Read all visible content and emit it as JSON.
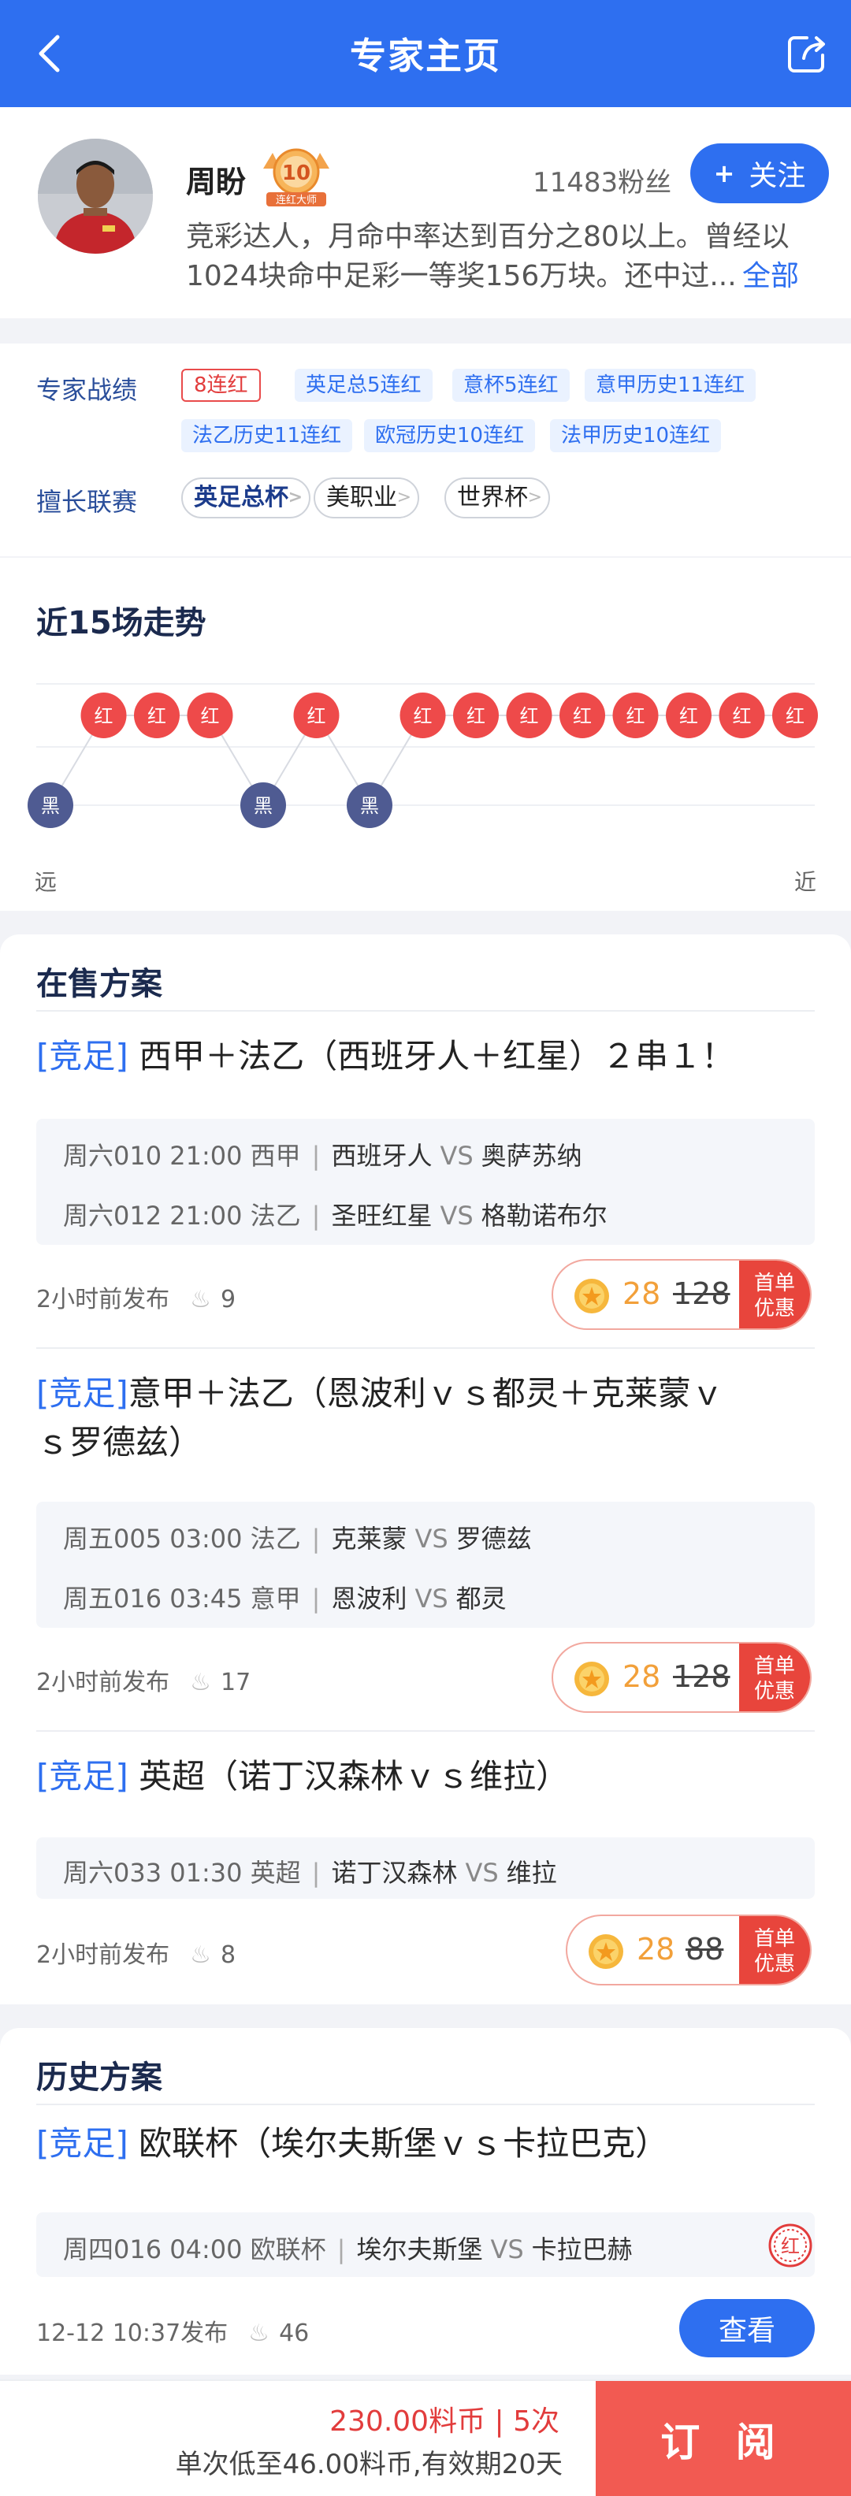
{
  "header": {
    "title": "专家主页",
    "accent": "#2e6ff0"
  },
  "profile": {
    "name": "周盼",
    "medal_number": "10",
    "medal_label": "连红大师",
    "fans": "11483粉丝",
    "follow_label": "关注",
    "bio_line1": "竞彩达人，月命中率达到百分之80以上。曾经以",
    "bio_line2": "1024块命中足彩一等奖156万块。还中过...",
    "bio_more": "全部"
  },
  "records": {
    "label": "专家战绩",
    "tags": [
      "8连红",
      "英足总5连红",
      "意杯5连红",
      "意甲历史11连红",
      "法乙历史11连红",
      "欧冠历史10连红",
      "法甲历史10连红"
    ],
    "league_label": "擅长联赛",
    "leagues": [
      "英足总杯",
      "美职业",
      "世界杯"
    ]
  },
  "trend": {
    "title": "近15场走势",
    "results": [
      "黑",
      "红",
      "红",
      "红",
      "黑",
      "红",
      "黑",
      "红",
      "红",
      "红",
      "红",
      "红",
      "红",
      "红",
      "红"
    ],
    "far_label": "远",
    "near_label": "近",
    "win_color": "#ee4a4a",
    "loss_color": "#4f5b92"
  },
  "sale": {
    "title": "在售方案",
    "plans": [
      {
        "kind": "[竞足]",
        "title": "西甲＋法乙（西班牙人＋红星）２串１！",
        "matches": [
          {
            "meta": "周六010 21:00 西甲",
            "home": "西班牙人",
            "vs": "VS",
            "away": "奥萨苏纳"
          },
          {
            "meta": "周六012 21:00 法乙",
            "home": "圣旺红星",
            "vs": "VS",
            "away": "格勒诺布尔"
          }
        ],
        "published": "2小时前发布",
        "heat": "9",
        "price": "28",
        "old_price": "128",
        "badge_line1": "首单",
        "badge_line2": "优惠"
      },
      {
        "kind": "[竞足]",
        "title_line1": "意甲＋法乙（恩波利ｖｓ都灵＋克莱蒙ｖ",
        "title_line2": "ｓ罗德兹）",
        "matches": [
          {
            "meta": "周五005 03:00 法乙",
            "home": "克莱蒙",
            "vs": "VS",
            "away": "罗德兹"
          },
          {
            "meta": "周五016 03:45 意甲",
            "home": "恩波利",
            "vs": "VS",
            "away": "都灵"
          }
        ],
        "published": "2小时前发布",
        "heat": "17",
        "price": "28",
        "old_price": "128",
        "badge_line1": "首单",
        "badge_line2": "优惠"
      },
      {
        "kind": "[竞足]",
        "title": "英超（诺丁汉森林ｖｓ维拉）",
        "matches": [
          {
            "meta": "周六033 01:30 英超",
            "home": "诺丁汉森林",
            "vs": "VS",
            "away": "维拉"
          }
        ],
        "published": "2小时前发布",
        "heat": "8",
        "price": "28",
        "old_price": "88",
        "badge_line1": "首单",
        "badge_line2": "优惠"
      }
    ]
  },
  "history": {
    "title": "历史方案",
    "plans": [
      {
        "kind": "[竞足]",
        "title": "欧联杯（埃尔夫斯堡ｖｓ卡拉巴克）",
        "matches": [
          {
            "meta": "周四016 04:00 欧联杯",
            "home": "埃尔夫斯堡",
            "vs": "VS",
            "away": "卡拉巴赫"
          }
        ],
        "result_stamp": "红",
        "published": "12-12 10:37发布",
        "heat": "46",
        "view_label": "查看"
      }
    ]
  },
  "bottom": {
    "price_line": "230.00料币 | 5次",
    "detail_line": "单次低至46.00料币,有效期20天",
    "subscribe_label": "订 阅"
  }
}
